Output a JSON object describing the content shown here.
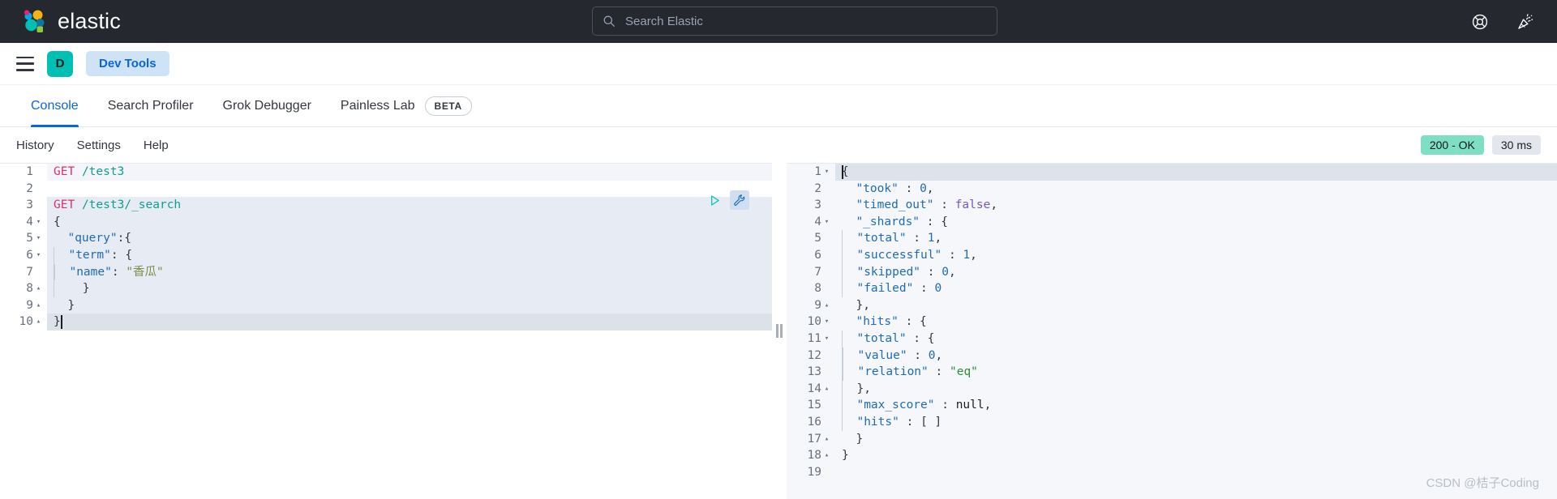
{
  "header": {
    "brand": "elastic",
    "logo_icon": "elastic-logo-icon",
    "search": {
      "icon": "search-icon",
      "placeholder": "Search Elastic",
      "value": ""
    },
    "actions": [
      {
        "icon": "help-lifebuoy-icon",
        "label": "Help"
      },
      {
        "icon": "whats-new-party-popper-icon",
        "label": "What's new"
      }
    ]
  },
  "app_nav": {
    "menu_icon": "hamburger-menu-icon",
    "avatar_initial": "D",
    "app_badge": "Dev Tools"
  },
  "tabs": [
    {
      "label": "Console",
      "active": true,
      "badge": ""
    },
    {
      "label": "Search Profiler",
      "active": false,
      "badge": ""
    },
    {
      "label": "Grok Debugger",
      "active": false,
      "badge": ""
    },
    {
      "label": "Painless Lab",
      "active": false,
      "badge": "BETA"
    }
  ],
  "subbar": {
    "links": [
      "History",
      "Settings",
      "Help"
    ],
    "status_code": "200 - OK",
    "status_time": "30 ms"
  },
  "request_editor": {
    "actions": [
      {
        "icon": "play-triangle-icon",
        "label": "Click to send request"
      },
      {
        "icon": "wrench-icon",
        "label": "Open documentation / options"
      }
    ],
    "lines": [
      {
        "n": "1",
        "fold": "",
        "state": "tinted",
        "tokens": [
          {
            "t": "method",
            "v": "GET"
          },
          {
            "t": "punc",
            "v": " "
          },
          {
            "t": "url",
            "v": "/test3"
          }
        ]
      },
      {
        "n": "2",
        "fold": "",
        "state": "tinted",
        "tokens": []
      },
      {
        "n": "3",
        "fold": "",
        "state": "selected",
        "tokens": [
          {
            "t": "method",
            "v": "GET"
          },
          {
            "t": "punc",
            "v": " "
          },
          {
            "t": "url",
            "v": "/test3/_search"
          }
        ]
      },
      {
        "n": "4",
        "fold": "▾",
        "state": "selected",
        "tokens": [
          {
            "t": "punc",
            "v": "{"
          }
        ]
      },
      {
        "n": "5",
        "fold": "▾",
        "state": "selected",
        "tokens": [
          {
            "t": "punc",
            "v": "  "
          },
          {
            "t": "key",
            "v": "\"query\""
          },
          {
            "t": "punc",
            "v": ":{"
          }
        ]
      },
      {
        "n": "6",
        "fold": "▾",
        "state": "selected",
        "tokens": [
          {
            "t": "guide",
            "v": "  "
          },
          {
            "t": "punc",
            "v": "  "
          },
          {
            "t": "key",
            "v": "\"term\""
          },
          {
            "t": "punc",
            "v": ": {"
          }
        ]
      },
      {
        "n": "7",
        "fold": "",
        "state": "selected",
        "tokens": [
          {
            "t": "guide",
            "v": "  "
          },
          {
            "t": "guide",
            "v": "  "
          },
          {
            "t": "punc",
            "v": "  "
          },
          {
            "t": "key",
            "v": "\"name\""
          },
          {
            "t": "punc",
            "v": ": "
          },
          {
            "t": "cjk",
            "v": "\"香瓜\""
          }
        ]
      },
      {
        "n": "8",
        "fold": "▴",
        "state": "selected",
        "tokens": [
          {
            "t": "guide",
            "v": "  "
          },
          {
            "t": "punc",
            "v": "    }"
          }
        ]
      },
      {
        "n": "9",
        "fold": "▴",
        "state": "selected",
        "tokens": [
          {
            "t": "punc",
            "v": "  }"
          }
        ]
      },
      {
        "n": "10",
        "fold": "▴",
        "state": "cursorline",
        "tokens": [
          {
            "t": "punc",
            "v": "}"
          }
        ]
      }
    ]
  },
  "response_viewer": {
    "lines": [
      {
        "n": "1",
        "fold": "▾",
        "state": "resp-active",
        "tokens": [
          {
            "t": "punc",
            "v": "{"
          }
        ]
      },
      {
        "n": "2",
        "fold": "",
        "state": "",
        "tokens": [
          {
            "t": "punc",
            "v": "  "
          },
          {
            "t": "key",
            "v": "\"took\""
          },
          {
            "t": "punc",
            "v": " : "
          },
          {
            "t": "num",
            "v": "0"
          },
          {
            "t": "punc",
            "v": ","
          }
        ]
      },
      {
        "n": "3",
        "fold": "",
        "state": "",
        "tokens": [
          {
            "t": "punc",
            "v": "  "
          },
          {
            "t": "key",
            "v": "\"timed_out\""
          },
          {
            "t": "punc",
            "v": " : "
          },
          {
            "t": "bool",
            "v": "false"
          },
          {
            "t": "punc",
            "v": ","
          }
        ]
      },
      {
        "n": "4",
        "fold": "▾",
        "state": "",
        "tokens": [
          {
            "t": "punc",
            "v": "  "
          },
          {
            "t": "key",
            "v": "\"_shards\""
          },
          {
            "t": "punc",
            "v": " : {"
          }
        ]
      },
      {
        "n": "5",
        "fold": "",
        "state": "",
        "tokens": [
          {
            "t": "guide",
            "v": "  "
          },
          {
            "t": "punc",
            "v": "  "
          },
          {
            "t": "key",
            "v": "\"total\""
          },
          {
            "t": "punc",
            "v": " : "
          },
          {
            "t": "num",
            "v": "1"
          },
          {
            "t": "punc",
            "v": ","
          }
        ]
      },
      {
        "n": "6",
        "fold": "",
        "state": "",
        "tokens": [
          {
            "t": "guide",
            "v": "  "
          },
          {
            "t": "punc",
            "v": "  "
          },
          {
            "t": "key",
            "v": "\"successful\""
          },
          {
            "t": "punc",
            "v": " : "
          },
          {
            "t": "num",
            "v": "1"
          },
          {
            "t": "punc",
            "v": ","
          }
        ]
      },
      {
        "n": "7",
        "fold": "",
        "state": "",
        "tokens": [
          {
            "t": "guide",
            "v": "  "
          },
          {
            "t": "punc",
            "v": "  "
          },
          {
            "t": "key",
            "v": "\"skipped\""
          },
          {
            "t": "punc",
            "v": " : "
          },
          {
            "t": "num",
            "v": "0"
          },
          {
            "t": "punc",
            "v": ","
          }
        ]
      },
      {
        "n": "8",
        "fold": "",
        "state": "",
        "tokens": [
          {
            "t": "guide",
            "v": "  "
          },
          {
            "t": "punc",
            "v": "  "
          },
          {
            "t": "key",
            "v": "\"failed\""
          },
          {
            "t": "punc",
            "v": " : "
          },
          {
            "t": "num",
            "v": "0"
          }
        ]
      },
      {
        "n": "9",
        "fold": "▴",
        "state": "",
        "tokens": [
          {
            "t": "punc",
            "v": "  },"
          }
        ]
      },
      {
        "n": "10",
        "fold": "▾",
        "state": "",
        "tokens": [
          {
            "t": "punc",
            "v": "  "
          },
          {
            "t": "key",
            "v": "\"hits\""
          },
          {
            "t": "punc",
            "v": " : {"
          }
        ]
      },
      {
        "n": "11",
        "fold": "▾",
        "state": "",
        "tokens": [
          {
            "t": "guide",
            "v": "  "
          },
          {
            "t": "punc",
            "v": "  "
          },
          {
            "t": "key",
            "v": "\"total\""
          },
          {
            "t": "punc",
            "v": " : {"
          }
        ]
      },
      {
        "n": "12",
        "fold": "",
        "state": "",
        "tokens": [
          {
            "t": "guide",
            "v": "  "
          },
          {
            "t": "guide",
            "v": "  "
          },
          {
            "t": "punc",
            "v": "  "
          },
          {
            "t": "key",
            "v": "\"value\""
          },
          {
            "t": "punc",
            "v": " : "
          },
          {
            "t": "num",
            "v": "0"
          },
          {
            "t": "punc",
            "v": ","
          }
        ]
      },
      {
        "n": "13",
        "fold": "",
        "state": "",
        "tokens": [
          {
            "t": "guide",
            "v": "  "
          },
          {
            "t": "guide",
            "v": "  "
          },
          {
            "t": "punc",
            "v": "  "
          },
          {
            "t": "key",
            "v": "\"relation\""
          },
          {
            "t": "punc",
            "v": " : "
          },
          {
            "t": "str",
            "v": "\"eq\""
          }
        ]
      },
      {
        "n": "14",
        "fold": "▴",
        "state": "",
        "tokens": [
          {
            "t": "guide",
            "v": "  "
          },
          {
            "t": "punc",
            "v": "  },"
          }
        ]
      },
      {
        "n": "15",
        "fold": "",
        "state": "",
        "tokens": [
          {
            "t": "guide",
            "v": "  "
          },
          {
            "t": "punc",
            "v": "  "
          },
          {
            "t": "key",
            "v": "\"max_score\""
          },
          {
            "t": "punc",
            "v": " : "
          },
          {
            "t": "null",
            "v": "null"
          },
          {
            "t": "punc",
            "v": ","
          }
        ]
      },
      {
        "n": "16",
        "fold": "",
        "state": "",
        "tokens": [
          {
            "t": "guide",
            "v": "  "
          },
          {
            "t": "punc",
            "v": "  "
          },
          {
            "t": "key",
            "v": "\"hits\""
          },
          {
            "t": "punc",
            "v": " : "
          },
          {
            "t": "punc",
            "v": "[ ]"
          }
        ]
      },
      {
        "n": "17",
        "fold": "▴",
        "state": "",
        "tokens": [
          {
            "t": "punc",
            "v": "  }"
          }
        ]
      },
      {
        "n": "18",
        "fold": "▴",
        "state": "",
        "tokens": [
          {
            "t": "punc",
            "v": "}"
          }
        ]
      },
      {
        "n": "19",
        "fold": "",
        "state": "",
        "tokens": []
      }
    ]
  },
  "watermark": "CSDN @桔子Coding",
  "colors": {
    "header_bg": "#25282f",
    "accent_blue": "#0b64dd",
    "avatar_teal": "#00bfb3",
    "status_ok_bg": "#7ddfc3",
    "method_pink": "#d6336c",
    "url_teal": "#0f9d8f"
  }
}
